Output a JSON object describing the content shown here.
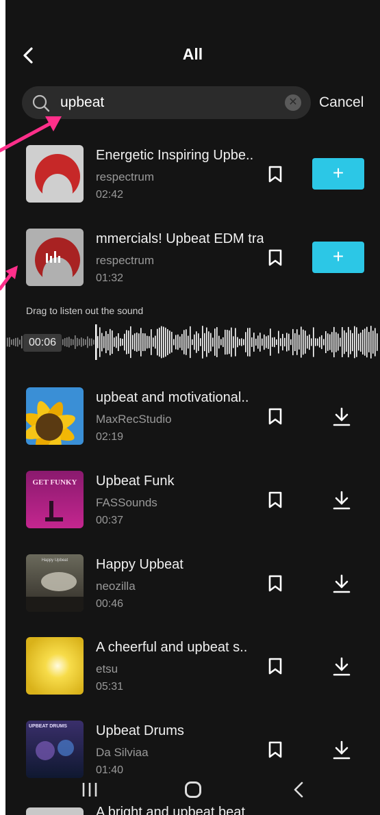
{
  "header": {
    "title": "All",
    "back_icon": "chevron-left-icon"
  },
  "search": {
    "value": "upbeat",
    "placeholder": "",
    "cancel_label": "Cancel",
    "icon": "search-icon"
  },
  "tracks": [
    {
      "name": "Energetic Inspiring Upbe..",
      "artist": "respectrum",
      "duration": "02:42",
      "action": "+"
    },
    {
      "name": "mmercials! Upbeat EDM tra",
      "artist": "respectrum",
      "duration": "01:32",
      "action": "+"
    },
    {
      "name": "upbeat and motivational..",
      "artist": "MaxRecStudio",
      "duration": "02:19"
    },
    {
      "name": "Upbeat Funk",
      "artist": "FASSounds",
      "duration": "00:37"
    },
    {
      "name": "Happy Upbeat",
      "artist": "neozilla",
      "duration": "00:46"
    },
    {
      "name": "A cheerful and upbeat s..",
      "artist": "etsu",
      "duration": "05:31"
    },
    {
      "name": "Upbeat Drums",
      "artist": "Da Silviaa",
      "duration": "01:40"
    }
  ],
  "player": {
    "hint": "Drag to listen out the sound",
    "position": "00:06"
  },
  "thumb_text": {
    "funk": "GET FUNKY",
    "drums": "UPBEAT DRUMS",
    "happy": "Happy Upbeat"
  },
  "partial_track": {
    "name": "A bright and upbeat beat"
  },
  "colors": {
    "background": "#141414",
    "accent": "#2cc7e6",
    "annotation": "#ff2f8a"
  }
}
